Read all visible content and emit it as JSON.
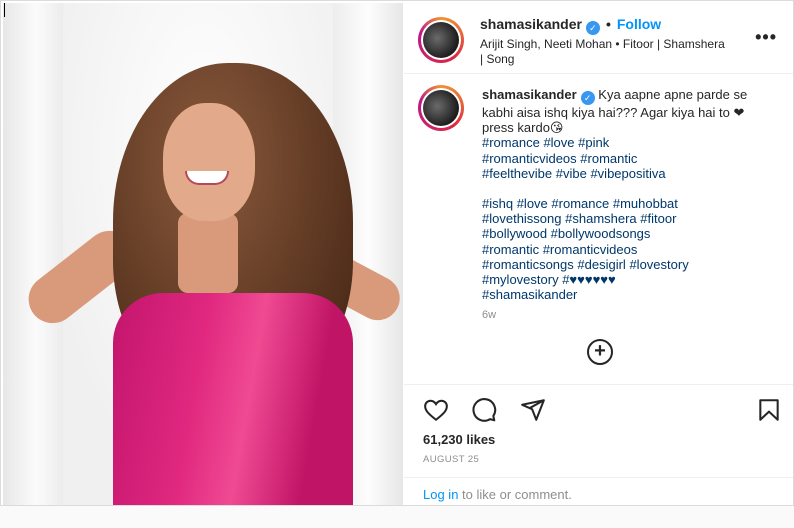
{
  "post": {
    "username": "shamasikander",
    "verified_mark": "✓",
    "separator": "•",
    "follow_label": "Follow",
    "audio_label": "Arijit Singh, Neeti Mohan • Fitoor | Shamshera | Song",
    "more_icon": "•••"
  },
  "caption": {
    "username": "shamasikander",
    "text_1": "Kya aapne apne parde se kabhi aisa ishq kiya hai??? Agar kiya hai to",
    "heart_emoji": "❤",
    "text_2": "press kardo",
    "emoji_end": "😘",
    "tags_1": [
      "#romance",
      "#love",
      "#pink",
      "#romanticvideos",
      "#romantic",
      "#feelthevibe",
      "#vibe",
      "#vibepositiva"
    ],
    "tags_2": [
      "#ishq",
      "#love",
      "#romance",
      "#muhobbat",
      "#lovethissong",
      "#shamshera",
      "#fitoor",
      "#bollywood",
      "#bollywoodsongs",
      "#romantic",
      "#romanticvideos",
      "#romanticsongs",
      "#desigirl",
      "#lovestory",
      "#mylovestory",
      "#♥♥♥♥♥♥",
      "#shamasikander"
    ],
    "time": "6w"
  },
  "load_more_icon": "+",
  "stats": {
    "likes": "61,230 likes",
    "date": "AUGUST 25"
  },
  "footer": {
    "login_link": "Log in",
    "login_rest": "to like or comment."
  },
  "icons": [
    "heart-icon",
    "comment-icon",
    "share-icon",
    "bookmark-icon",
    "add-circle-icon",
    "more-icon",
    "verified-icon"
  ]
}
